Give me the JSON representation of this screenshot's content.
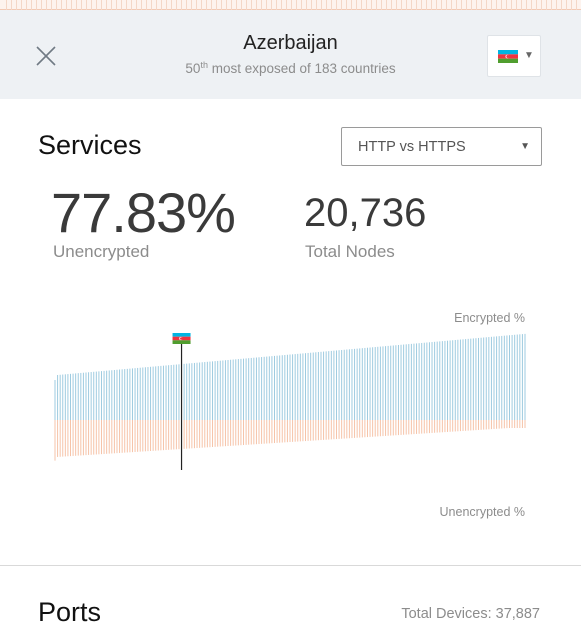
{
  "header": {
    "country": "Azerbaijan",
    "rank_number": "50",
    "rank_suffix": "th",
    "rank_text": " most exposed of 183 countries"
  },
  "services": {
    "title": "Services",
    "selector_value": "HTTP vs HTTPS",
    "unencrypted_value": "77.83%",
    "unencrypted_label": "Unencrypted",
    "nodes_value": "20,736",
    "nodes_label": "Total Nodes"
  },
  "chart_data": {
    "type": "bar",
    "orientation": "diverging",
    "top_series_name": "Encrypted %",
    "bottom_series_name": "Unencrypted %",
    "highlighted_country": "Azerbaijan",
    "highlight_index": 49,
    "country_count": 183,
    "colors": {
      "encrypted": "#9ecbe0",
      "unencrypted": "#f6c3a8",
      "marker": "#222222"
    },
    "encrypted_percent_range": [
      15,
      45
    ],
    "trend": "encrypted share increases steadily from left to right"
  },
  "ports": {
    "title": "Ports",
    "total_devices": "Total Devices: 37,887"
  }
}
